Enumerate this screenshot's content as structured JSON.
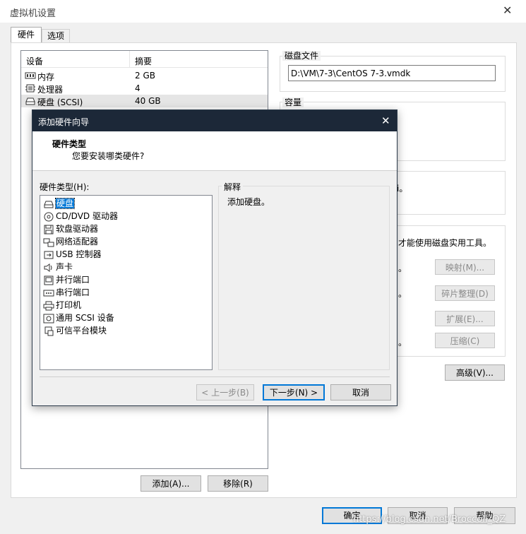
{
  "window": {
    "title": "虚拟机设置",
    "close_glyph": "✕"
  },
  "tabs": [
    {
      "label": "硬件"
    },
    {
      "label": "选项"
    }
  ],
  "device_list": {
    "col_device": "设备",
    "col_summary": "摘要",
    "rows": [
      {
        "name": "内存",
        "summary": "2 GB",
        "icon": "memory-icon"
      },
      {
        "name": "处理器",
        "summary": "4",
        "icon": "processor-icon"
      },
      {
        "name": "硬盘 (SCSI)",
        "summary": "40 GB",
        "icon": "hard-disk-icon"
      }
    ],
    "add_button": "添加(A)...",
    "remove_button": "移除(R)"
  },
  "right_panel": {
    "disk_file_title": "磁盘文件",
    "disk_file_value": "D:\\VM\\7-3\\CentOS 7-3.vmdk",
    "capacity_title": "容量",
    "partial_text_1": "i。",
    "utility_text": "才能使用磁盘实用工具。",
    "partial_dot": "。",
    "map_button": "映射(M)...",
    "defrag_button": "碎片整理(D)",
    "expand_button": "扩展(E)...",
    "compact_button": "压缩(C)",
    "advanced_button": "高级(V)..."
  },
  "bottom_buttons": {
    "ok": "确定",
    "cancel": "取消",
    "help": "帮助"
  },
  "watermark": "https://blog.csdn.net/Broccoli_QZ",
  "wizard": {
    "title": "添加硬件向导",
    "close_glyph": "✕",
    "header_title": "硬件类型",
    "header_subtitle": "您要安装哪类硬件?",
    "list_label": "硬件类型(H):",
    "items": [
      {
        "label": "硬盘",
        "icon": "hard-disk-icon"
      },
      {
        "label": "CD/DVD 驱动器",
        "icon": "cd-dvd-icon"
      },
      {
        "label": "软盘驱动器",
        "icon": "floppy-icon"
      },
      {
        "label": "网络适配器",
        "icon": "network-adapter-icon"
      },
      {
        "label": "USB 控制器",
        "icon": "usb-icon"
      },
      {
        "label": "声卡",
        "icon": "sound-card-icon"
      },
      {
        "label": "并行端口",
        "icon": "parallel-port-icon"
      },
      {
        "label": "串行端口",
        "icon": "serial-port-icon"
      },
      {
        "label": "打印机",
        "icon": "printer-icon"
      },
      {
        "label": "通用 SCSI 设备",
        "icon": "scsi-device-icon"
      },
      {
        "label": "可信平台模块",
        "icon": "tpm-icon"
      }
    ],
    "explain_title": "解释",
    "explain_text": "添加硬盘。",
    "back_button": "< 上一步(B)",
    "next_button": "下一步(N) >",
    "cancel_button": "取消"
  }
}
